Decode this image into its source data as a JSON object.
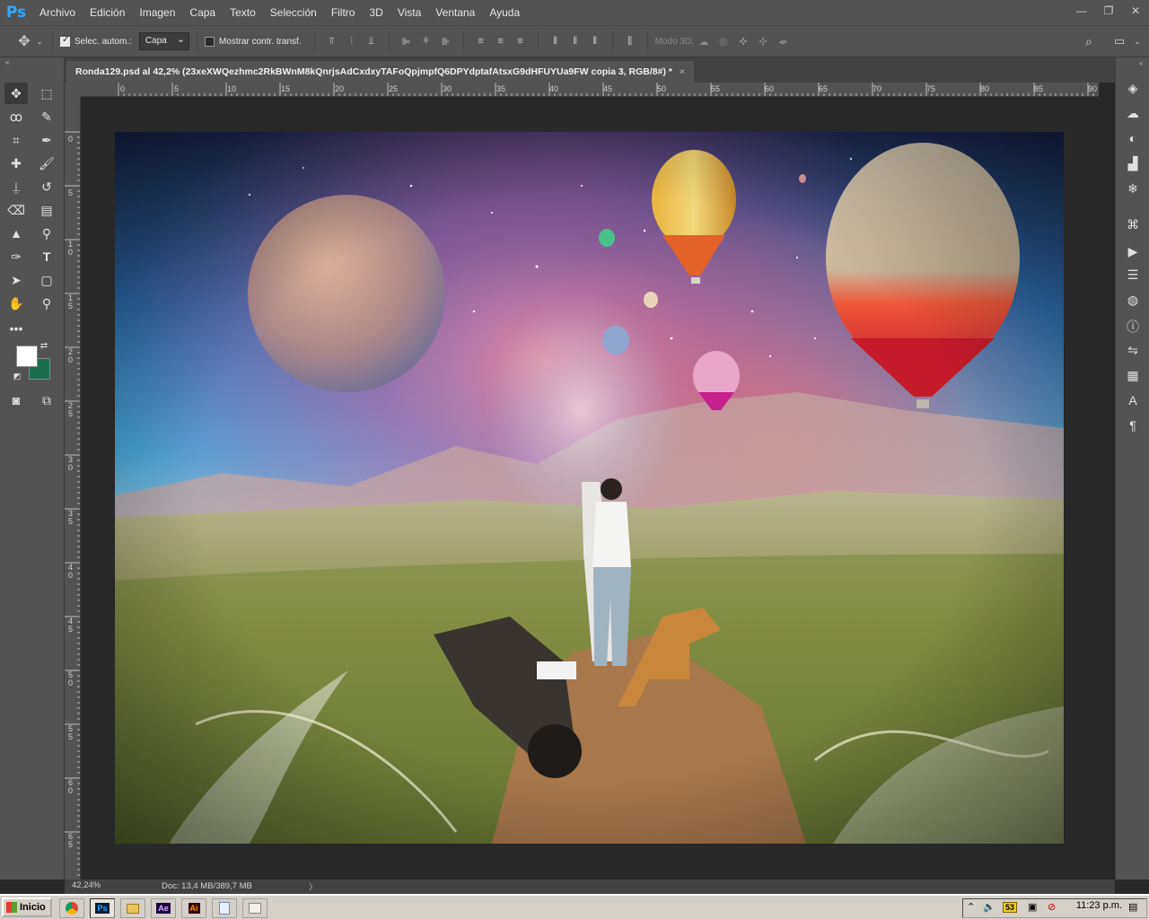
{
  "app": {
    "logo": "Ps",
    "menu": [
      "Archivo",
      "Edición",
      "Imagen",
      "Capa",
      "Texto",
      "Selección",
      "Filtro",
      "3D",
      "Vista",
      "Ventana",
      "Ayuda"
    ]
  },
  "options_bar": {
    "auto_select_label": "Selec. autom.:",
    "auto_select_checked": true,
    "auto_select_value": "Capa",
    "transform_label": "Mostrar contr. transf.",
    "transform_checked": false,
    "mode_3d_label": "Modo 3D:"
  },
  "document": {
    "tab_title": "Ronda129.psd al 42,2% (23xeXWQezhmc2RkBWnM8kQnrjsAdCxdxyTAFoQpjmpfQ6DPYdptafAtsxG9dHFUYUa9FW copia 3, RGB/8#) *",
    "close_symbol": "×"
  },
  "rulers": {
    "top": [
      "0",
      "5",
      "10",
      "15",
      "20",
      "25",
      "30",
      "35",
      "40",
      "45",
      "50",
      "55",
      "60",
      "65",
      "70",
      "75",
      "80",
      "85",
      "90"
    ],
    "left": [
      "0",
      "5",
      "1 0",
      "1 5",
      "2 0",
      "2 5",
      "3 0",
      "3 5",
      "4 0",
      "4 5",
      "5 0",
      "5 5",
      "6 0",
      "6 5"
    ]
  },
  "status": {
    "zoom": "42,24%",
    "doc_size": "Doc: 13,4 MB/389,7 MB",
    "arrow": "〉"
  },
  "colors": {
    "foreground": "#ffffff",
    "background": "#1a6e4e",
    "accent": "#31a8ff"
  },
  "taskbar": {
    "start_label": "Inicio",
    "apps": [
      "chrome-icon",
      "Ps",
      "folder-icon",
      "Ae",
      "Ai",
      "notepad-icon",
      "paint-icon"
    ],
    "app_labels": {
      "ps": "Ps",
      "ae": "Ae",
      "ai": "Ai"
    },
    "clock": "11:23 p.m.",
    "tray_badge": "53"
  }
}
